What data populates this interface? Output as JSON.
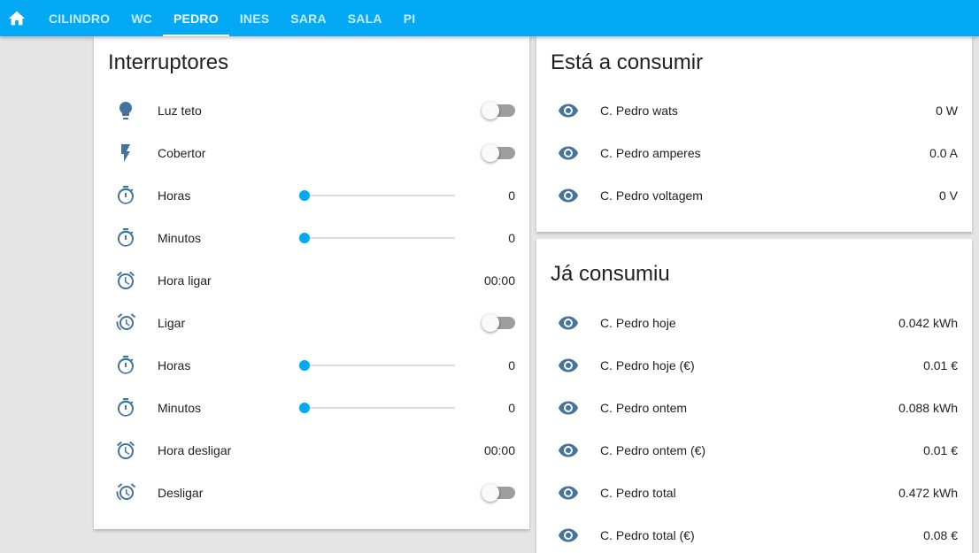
{
  "header": {
    "home_icon": "home-icon",
    "tabs": [
      {
        "label": "CILINDRO",
        "active": false
      },
      {
        "label": "WC",
        "active": false
      },
      {
        "label": "PEDRO",
        "active": true
      },
      {
        "label": "INES",
        "active": false
      },
      {
        "label": "SARA",
        "active": false
      },
      {
        "label": "SALA",
        "active": false
      },
      {
        "label": "PI",
        "active": false
      }
    ]
  },
  "colors": {
    "accent": "#03a9f4",
    "icon": "#44739e",
    "toggle_off": "#9e9e9e"
  },
  "switches_card": {
    "title": "Interruptores",
    "rows": [
      {
        "label": "Luz teto",
        "icon": "lightbulb-icon",
        "type": "toggle",
        "on": false
      },
      {
        "label": "Cobertor",
        "icon": "flash-icon",
        "type": "toggle",
        "on": false
      },
      {
        "label": "Horas",
        "icon": "timer-icon",
        "type": "slider",
        "value": "0",
        "fraction": 0
      },
      {
        "label": "Minutos",
        "icon": "timer-icon",
        "type": "slider",
        "value": "0",
        "fraction": 0
      },
      {
        "label": "Hora ligar",
        "icon": "alarm-icon",
        "type": "text",
        "value": "00:00"
      },
      {
        "label": "Ligar",
        "icon": "alarm-multiple-icon",
        "type": "toggle",
        "on": false
      },
      {
        "label": "Horas",
        "icon": "timer-icon",
        "type": "slider",
        "value": "0",
        "fraction": 0
      },
      {
        "label": "Minutos",
        "icon": "timer-icon",
        "type": "slider",
        "value": "0",
        "fraction": 0
      },
      {
        "label": "Hora desligar",
        "icon": "alarm-icon",
        "type": "text",
        "value": "00:00"
      },
      {
        "label": "Desligar",
        "icon": "alarm-multiple-icon",
        "type": "toggle",
        "on": false
      }
    ]
  },
  "consuming_card": {
    "title": "Está a consumir",
    "rows": [
      {
        "label": "C. Pedro wats",
        "icon": "eye-icon",
        "value": "0 W"
      },
      {
        "label": "C. Pedro amperes",
        "icon": "eye-icon",
        "value": "0.0 A"
      },
      {
        "label": "C. Pedro voltagem",
        "icon": "eye-icon",
        "value": "0 V"
      }
    ]
  },
  "consumed_card": {
    "title": "Já consumiu",
    "rows": [
      {
        "label": "C. Pedro hoje",
        "icon": "eye-icon",
        "value": "0.042 kWh"
      },
      {
        "label": "C. Pedro hoje (€)",
        "icon": "eye-icon",
        "value": "0.01 €"
      },
      {
        "label": "C. Pedro ontem",
        "icon": "eye-icon",
        "value": "0.088 kWh"
      },
      {
        "label": "C. Pedro ontem (€)",
        "icon": "eye-icon",
        "value": "0.01 €"
      },
      {
        "label": "C. Pedro total",
        "icon": "eye-icon",
        "value": "0.472 kWh"
      },
      {
        "label": "C. Pedro total (€)",
        "icon": "eye-icon",
        "value": "0.08 €"
      }
    ]
  }
}
